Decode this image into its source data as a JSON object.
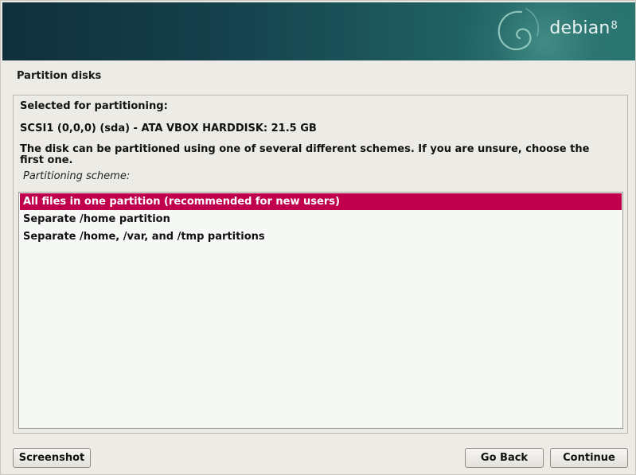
{
  "banner": {
    "brand_name": "debian",
    "brand_version": "8",
    "swirl_icon": "debian-swirl-icon"
  },
  "page": {
    "title": "Partition disks"
  },
  "content": {
    "selected_label": "Selected for partitioning:",
    "disk_info": "SCSI1 (0,0,0) (sda) - ATA VBOX HARDDISK: 21.5 GB",
    "description": "The disk can be partitioned using one of several different schemes. If you are unsure, choose the first one.",
    "scheme_label": "Partitioning scheme:"
  },
  "schemes": [
    {
      "label": "All files in one partition (recommended for new users)",
      "selected": true
    },
    {
      "label": "Separate /home partition",
      "selected": false
    },
    {
      "label": "Separate /home, /var, and /tmp partitions",
      "selected": false
    }
  ],
  "buttons": {
    "screenshot": "Screenshot",
    "go_back": "Go Back",
    "continue": "Continue"
  },
  "colors": {
    "selection": "#c0004c",
    "banner": "#15414c"
  }
}
